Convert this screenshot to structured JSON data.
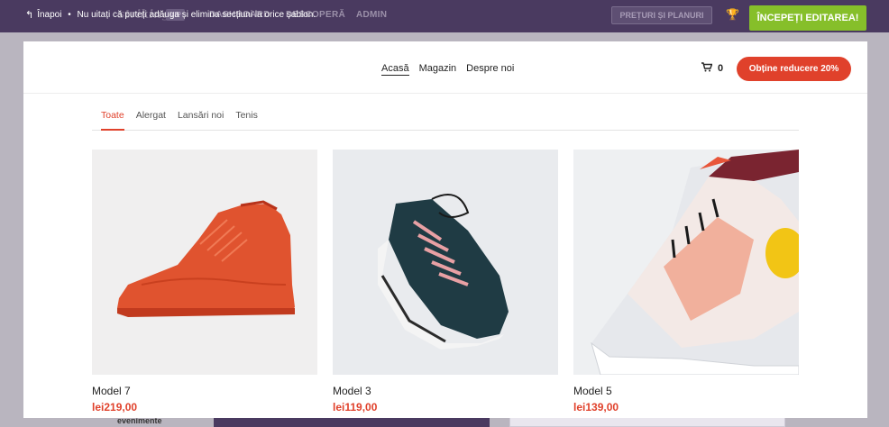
{
  "editor": {
    "brand": "strikingly",
    "vip": "VIP",
    "nav": [
      "DASHBOARD",
      "DESCOPERĂ",
      "ADMIN"
    ],
    "back_label": "Înapoi",
    "tip": "Nu uitați că puteți adăuga și elimina secțiuni la orice șablon.",
    "pricing_label": "PREȚURI ȘI PLANURI",
    "start_label": "ÎNCEPEȚI EDITAREA!",
    "underlay_text": "evenimente"
  },
  "site": {
    "nav": [
      {
        "label": "Acasă",
        "active": true
      },
      {
        "label": "Magazin",
        "active": false
      },
      {
        "label": "Despre noi",
        "active": false
      }
    ],
    "cart_count": "0",
    "discount_label": "Obține reducere 20%"
  },
  "shop": {
    "tabs": [
      {
        "label": "Toate",
        "active": true
      },
      {
        "label": "Alergat",
        "active": false
      },
      {
        "label": "Lansări noi",
        "active": false
      },
      {
        "label": "Tenis",
        "active": false
      }
    ],
    "products": [
      {
        "name": "Model 7",
        "price": "lei219,00",
        "image": "red-high-top-sneaker"
      },
      {
        "name": "Model 3",
        "price": "lei119,00",
        "image": "dark-green-running-shoe"
      },
      {
        "name": "Model 5",
        "price": "lei139,00",
        "image": "white-yellow-sneaker"
      }
    ]
  },
  "colors": {
    "editor_bar": "#4a3a60",
    "start_button": "#86bf2a",
    "accent": "#e0412b"
  }
}
